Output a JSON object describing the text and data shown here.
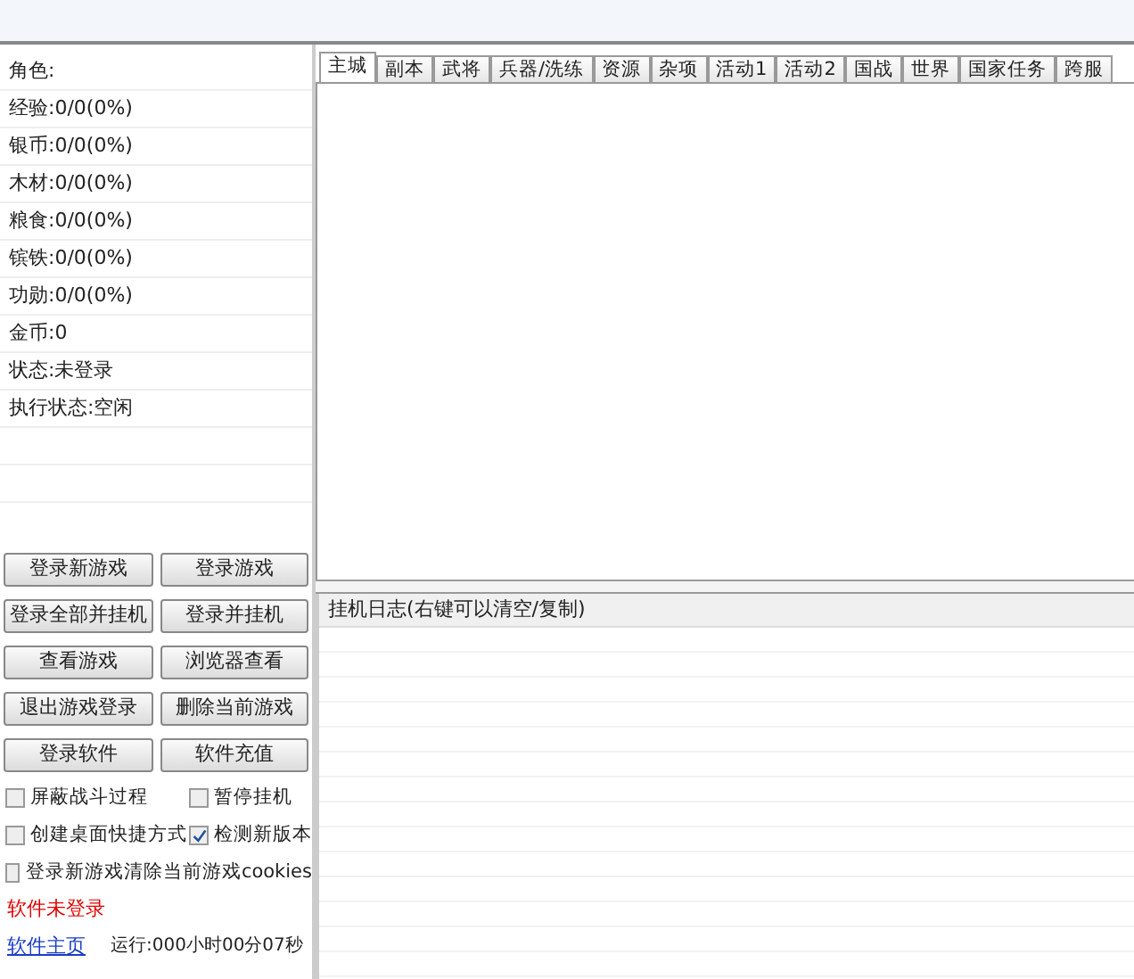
{
  "stats": [
    "角色:",
    "经验:0/0(0%)",
    "银币:0/0(0%)",
    "木材:0/0(0%)",
    "粮食:0/0(0%)",
    "镔铁:0/0(0%)",
    "功勋:0/0(0%)",
    "金币:0",
    "状态:未登录",
    "执行状态:空闲"
  ],
  "buttons": [
    "登录新游戏",
    "登录游戏",
    "登录全部并挂机",
    "登录并挂机",
    "查看游戏",
    "浏览器查看",
    "退出游戏登录",
    "删除当前游戏",
    "登录软件",
    "软件充值"
  ],
  "options": [
    {
      "label": "屏蔽战斗过程",
      "checked": false
    },
    {
      "label": "暂停挂机",
      "checked": false
    },
    {
      "label": "创建桌面快捷方式",
      "checked": false
    },
    {
      "label": "检测新版本",
      "checked": true
    },
    {
      "label": "登录新游戏清除当前游戏cookies",
      "checked": false
    }
  ],
  "login_status": "软件未登录",
  "homepage_link": "软件主页",
  "runtime": "运行:000小时00分07秒",
  "tabs": [
    {
      "label": "主城",
      "selected": true
    },
    {
      "label": "副本",
      "selected": false
    },
    {
      "label": "武将",
      "selected": false
    },
    {
      "label": "兵器/洗练",
      "selected": false
    },
    {
      "label": "资源",
      "selected": false
    },
    {
      "label": "杂项",
      "selected": false
    },
    {
      "label": "活动1",
      "selected": false
    },
    {
      "label": "活动2",
      "selected": false
    },
    {
      "label": "国战",
      "selected": false
    },
    {
      "label": "世界",
      "selected": false
    },
    {
      "label": "国家任务",
      "selected": false
    },
    {
      "label": "跨服",
      "selected": false
    }
  ],
  "log": {
    "header": "挂机日志(右键可以清空/复制)"
  }
}
